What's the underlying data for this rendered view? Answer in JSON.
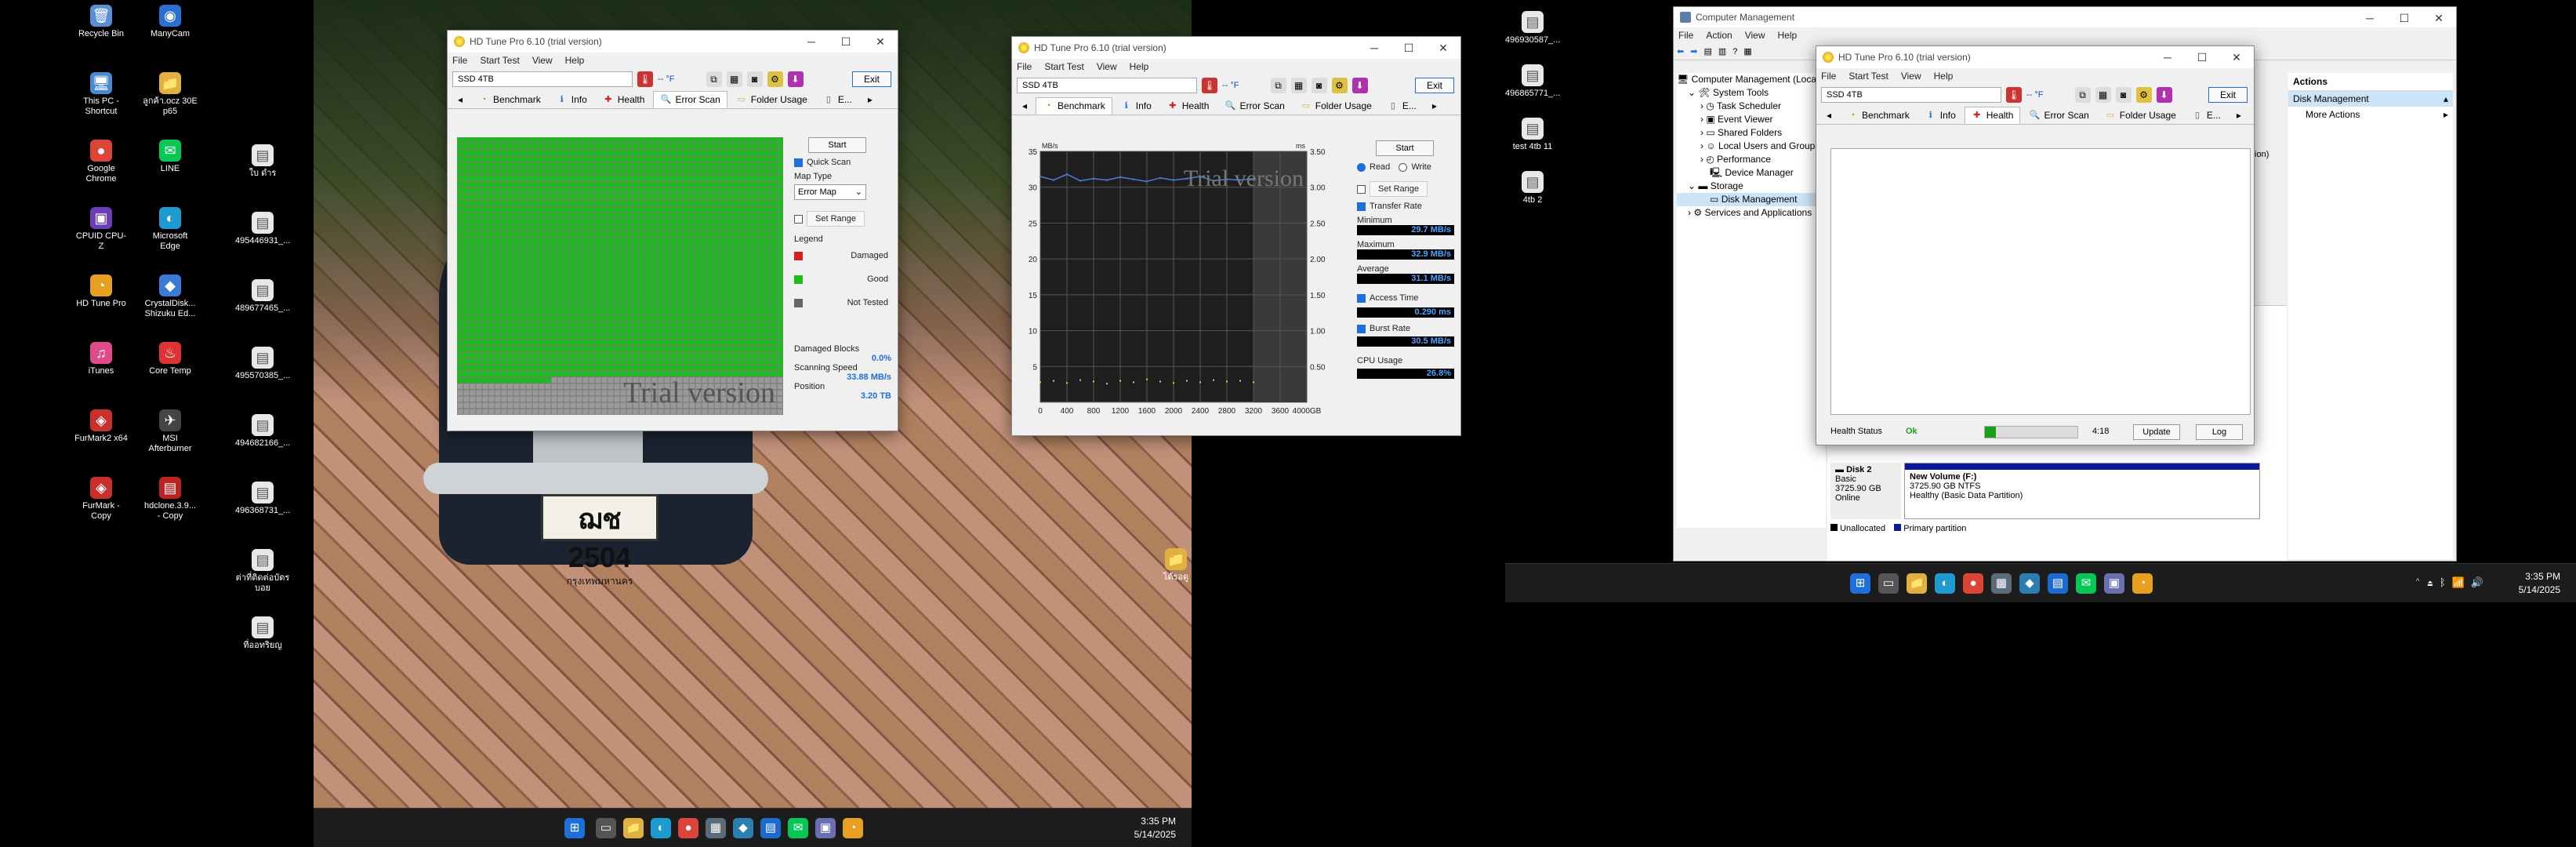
{
  "desktop_left": {
    "icons": [
      {
        "label": "Recycle Bin",
        "glyph": "🗑",
        "color": "#5a8fd6"
      },
      {
        "label": "ManyCam",
        "glyph": "◉",
        "color": "#2b6fd1"
      },
      {
        "label": "This PC - Shortcut",
        "glyph": "🖥",
        "color": "#4a8ad0"
      },
      {
        "label": "ลูกค้า.ocz 30E p65",
        "glyph": "📁",
        "color": "#e0b040"
      },
      {
        "label": "Google Chrome",
        "glyph": "●",
        "color": "#db4437"
      },
      {
        "label": "LINE",
        "glyph": "✉",
        "color": "#06c755"
      },
      {
        "label": "CPUID CPU-Z",
        "glyph": "▣",
        "color": "#6a3fb5"
      },
      {
        "label": "Microsoft Edge",
        "glyph": "◐",
        "color": "#1d9bd1"
      },
      {
        "label": "HD Tune Pro",
        "glyph": "◔",
        "color": "#e8a020"
      },
      {
        "label": "CrystalDisk... Shizuku Ed...",
        "glyph": "◆",
        "color": "#3a7bd5"
      },
      {
        "label": "iTunes",
        "glyph": "♫",
        "color": "#e04a8a"
      },
      {
        "label": "Core Temp",
        "glyph": "♨",
        "color": "#d33"
      },
      {
        "label": "FurMark2 x64",
        "glyph": "◈",
        "color": "#c9302c"
      },
      {
        "label": "MSI Afterburner",
        "glyph": "✈",
        "color": "#444"
      },
      {
        "label": "FurMark - Copy",
        "glyph": "◈",
        "color": "#c9302c"
      },
      {
        "label": "hdclone.3.9... - Copy",
        "glyph": "▤",
        "color": "#b22"
      }
    ],
    "file_icons": [
      {
        "label": "ใบ ดำร"
      },
      {
        "label": "495446931_..."
      },
      {
        "label": "489677465_..."
      },
      {
        "label": "495570385_..."
      },
      {
        "label": "494682166_..."
      },
      {
        "label": "496368731_..."
      },
      {
        "label": "ต่าที่ติดต่อบัตร บอย"
      },
      {
        "label": "ที่ออทริยญ"
      }
    ],
    "wallpaper_folder_label": "ได้รอดู",
    "plate_text": "ฌช 2504",
    "plate_sub": "กรุงเทพมหานคร",
    "taskbar_time": "3:35 PM",
    "taskbar_date": "5/14/2025"
  },
  "win_errorscan": {
    "title": "HD Tune Pro 6.10 (trial version)",
    "menu": [
      "File",
      "Start Test",
      "View",
      "Help"
    ],
    "drive": "SSD 4TB",
    "temp": "-- °F",
    "exit_label": "Exit",
    "tabs": [
      "Benchmark",
      "Info",
      "Health",
      "Error Scan",
      "Folder Usage",
      "E..."
    ],
    "active_tab": "Error Scan",
    "start_label": "Start",
    "quick_scan_label": "Quick Scan",
    "quick_scan_checked": true,
    "map_type_label": "Map Type",
    "map_type_value": "Error Map",
    "set_range_label": "Set Range",
    "legend_label": "Legend",
    "legend": [
      {
        "label": "Damaged",
        "color": "#d42020"
      },
      {
        "label": "Good",
        "color": "#18c018"
      },
      {
        "label": "Not Tested",
        "color": "#666666"
      }
    ],
    "damaged_blocks_label": "Damaged Blocks",
    "damaged_blocks_value": "0.0%",
    "scanning_speed_label": "Scanning Speed",
    "scanning_speed_value": "33.88 MB/s",
    "position_label": "Position",
    "position_value": "3.20 TB",
    "watermark": "Trial version",
    "scanned_fraction": 0.87
  },
  "win_benchmark": {
    "title": "HD Tune Pro 6.10 (trial version)",
    "menu": [
      "File",
      "Start Test",
      "View",
      "Help"
    ],
    "drive": "SSD 4TB",
    "temp": "-- °F",
    "exit_label": "Exit",
    "tabs": [
      "Benchmark",
      "Info",
      "Health",
      "Error Scan",
      "Folder Usage",
      "E..."
    ],
    "active_tab": "Benchmark",
    "start_label": "Start",
    "read_label": "Read",
    "write_label": "Write",
    "set_range_label": "Set Range",
    "transfer_rate_label": "Transfer Rate",
    "minimum_label": "Minimum",
    "minimum_value": "29.7 MB/s",
    "maximum_label": "Maximum",
    "maximum_value": "32.9 MB/s",
    "average_label": "Average",
    "average_value": "31.1 MB/s",
    "access_time_label": "Access Time",
    "access_time_value": "0.290 ms",
    "burst_rate_label": "Burst Rate",
    "burst_rate_value": "30.5 MB/s",
    "cpu_usage_label": "CPU Usage",
    "cpu_usage_value": "26.8%",
    "watermark": "Trial version"
  },
  "chart_data": {
    "type": "line",
    "title": "",
    "ylabel_left": "MB/s",
    "ylabel_right": "ms",
    "xlabel": "",
    "x_ticks": [
      "0",
      "400",
      "800",
      "1200",
      "1600",
      "2000",
      "2400",
      "2800",
      "3200",
      "3600",
      "4000GB"
    ],
    "y_ticks_left": [
      "35",
      "30",
      "25",
      "20",
      "15",
      "10",
      "5"
    ],
    "y_ticks_right": [
      "3.50",
      "3.00",
      "2.50",
      "2.00",
      "1.50",
      "1.00",
      "0.50"
    ],
    "ylim": [
      0,
      35
    ],
    "xlim": [
      0,
      4000
    ],
    "tested_until_gb": 3200,
    "series": [
      {
        "color": "#4a7fd8",
        "x": [
          0,
          200,
          400,
          600,
          800,
          1000,
          1200,
          1400,
          1600,
          1800,
          2000,
          2200,
          2400,
          2600,
          2800,
          3000,
          3200
        ],
        "y": [
          31.5,
          31.0,
          31.8,
          30.9,
          31.2,
          31.0,
          31.4,
          31.1,
          30.8,
          31.3,
          31.0,
          31.2,
          31.5,
          30.9,
          31.1,
          31.0,
          31.2
        ]
      }
    ],
    "access_points_ms": [
      0.28,
      0.3,
      0.27,
      0.31,
      0.29,
      0.26,
      0.3,
      0.28,
      0.32,
      0.29,
      0.27,
      0.3,
      0.28,
      0.31,
      0.29,
      0.3,
      0.28
    ]
  },
  "comp_mgmt": {
    "title": "Computer Management",
    "menu": [
      "File",
      "Action",
      "View",
      "Help"
    ],
    "tree_root": "Computer Management (Local",
    "tree": [
      "System Tools",
      "Task Scheduler",
      "Event Viewer",
      "Shared Folders",
      "Local Users and Groups",
      "Performance",
      "Device Manager",
      "Storage",
      "Disk Management",
      "Services and Applications"
    ],
    "actions_header": "Actions",
    "actions_selected": "Disk Management",
    "actions_more": "More Actions",
    "disk_name": "Disk 2",
    "disk_type": "Basic",
    "disk_size": "3725.90 GB",
    "disk_status": "Online",
    "volume_name": "New Volume (F:)",
    "volume_size": "3725.90 GB NTFS",
    "volume_health": "Healthy (Basic Data Partition)",
    "legend_unallocated": "Unallocated",
    "legend_primary": "Primary partition",
    "partial_label": "tion)"
  },
  "win_health": {
    "title": "HD Tune Pro 6.10 (trial version)",
    "menu": [
      "File",
      "Start Test",
      "View",
      "Help"
    ],
    "drive": "SSD 4TB",
    "temp": "-- °F",
    "exit_label": "Exit",
    "tabs": [
      "Benchmark",
      "Info",
      "Health",
      "Error Scan",
      "Folder Usage",
      "E..."
    ],
    "active_tab": "Health",
    "health_status_label": "Health Status",
    "health_status_value": "Ok",
    "time_value": "4:18",
    "update_label": "Update",
    "log_label": "Log"
  },
  "desktop_right": {
    "file_icons": [
      {
        "label": "496930587_..."
      },
      {
        "label": "496865771_..."
      },
      {
        "label": "test 4tb 11"
      },
      {
        "label": "4tb 2"
      }
    ],
    "taskbar_time": "3:35 PM",
    "taskbar_date": "5/14/2025"
  }
}
